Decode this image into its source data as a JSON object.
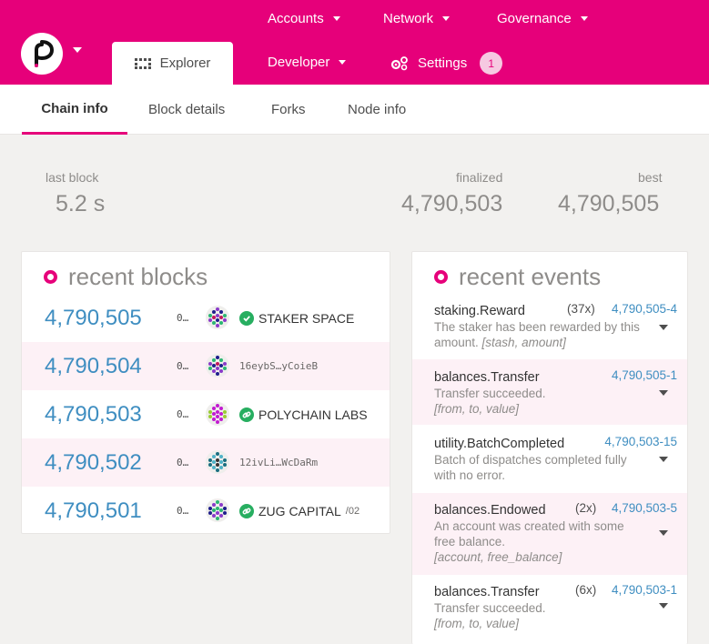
{
  "nav": {
    "accounts": "Accounts",
    "network": "Network",
    "governance": "Governance",
    "explorer": "Explorer",
    "developer": "Developer",
    "settings": "Settings",
    "settings_badge": "1"
  },
  "subnav": {
    "chain_info": "Chain info",
    "block_details": "Block details",
    "forks": "Forks",
    "node_info": "Node info"
  },
  "summary": {
    "last_block_label": "last block",
    "last_block_value": "5.2 s",
    "finalized_label": "finalized",
    "finalized_value": "4,790,503",
    "best_label": "best",
    "best_value": "4,790,505"
  },
  "blocks": {
    "title": "recent blocks",
    "rows": [
      {
        "number": "4,790,505",
        "hash": "0…",
        "author": "STAKER SPACE"
      },
      {
        "number": "4,790,504",
        "hash": "0…",
        "author": "16eybS…yCoieB"
      },
      {
        "number": "4,790,503",
        "hash": "0…",
        "author": "POLYCHAIN LABS"
      },
      {
        "number": "4,790,502",
        "hash": "0…",
        "author": "12ivLi…WcDaRm"
      },
      {
        "number": "4,790,501",
        "hash": "0…",
        "author": "ZUG CAPITAL",
        "author_suffix": "/02"
      }
    ]
  },
  "events": {
    "title": "recent events",
    "rows": [
      {
        "name": "staking.Reward",
        "count": "(37x)",
        "block": "4,790,505-4",
        "desc": "The staker has been rewarded by this amount.",
        "args": "[stash, amount]"
      },
      {
        "name": "balances.Transfer",
        "count": "",
        "block": "4,790,505-1",
        "desc": "Transfer succeeded.",
        "args": "[from, to, value]"
      },
      {
        "name": "utility.BatchCompleted",
        "count": "",
        "block": "4,790,503-15",
        "desc": "Batch of dispatches completed fully with no error.",
        "args": ""
      },
      {
        "name": "balances.Endowed",
        "count": "(2x)",
        "block": "4,790,503-5",
        "desc": "An account was created with some free balance.",
        "args": "[account, free_balance]"
      },
      {
        "name": "balances.Transfer",
        "count": "(6x)",
        "block": "4,790,503-1",
        "desc": "Transfer succeeded.",
        "args": "[from, to, value]"
      }
    ]
  },
  "colors": {
    "brand": "#e6007a",
    "link": "#3f8ec1",
    "row_alt": "#fdf1f6"
  }
}
